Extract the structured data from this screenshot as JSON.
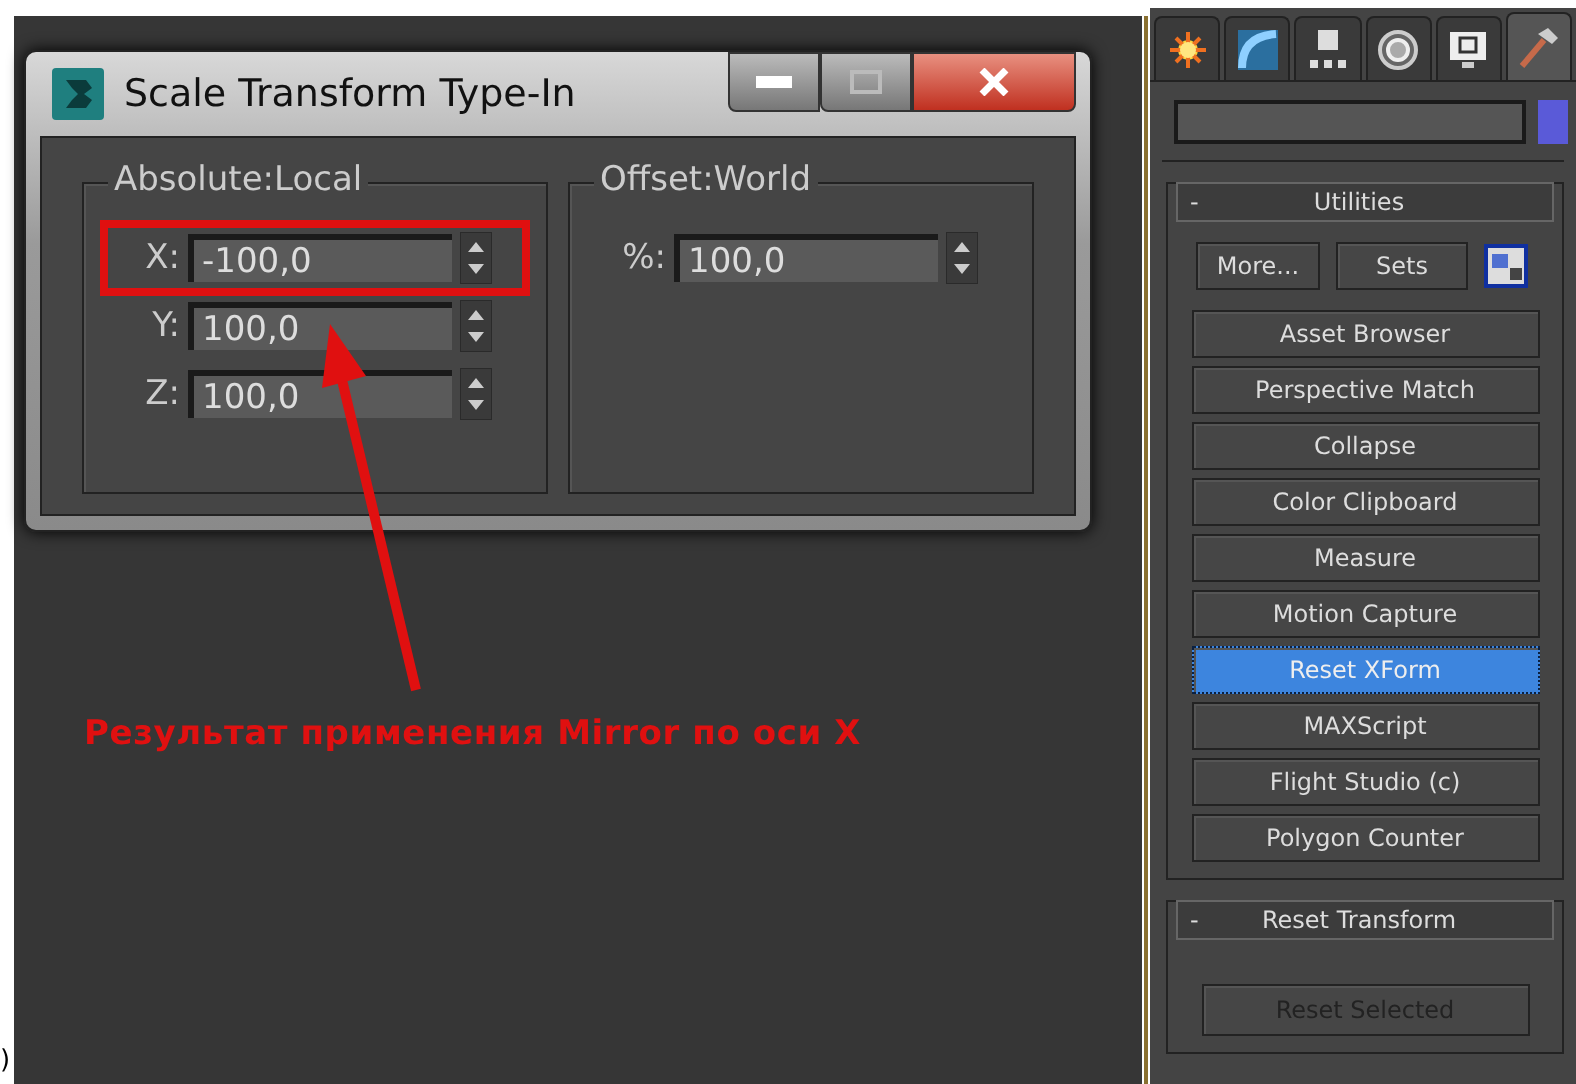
{
  "stray_mark": ")",
  "dialog": {
    "title": "Scale Transform Type-In",
    "groups": [
      {
        "title": "Absolute:Local",
        "fields": [
          {
            "label": "X:",
            "value": "-100,0",
            "highlighted": true
          },
          {
            "label": "Y:",
            "value": "100,0"
          },
          {
            "label": "Z:",
            "value": "100,0"
          }
        ]
      },
      {
        "title": "Offset:World",
        "fields": [
          {
            "label": "%:",
            "value": "100,0"
          }
        ]
      }
    ]
  },
  "annotation": {
    "text": "Результат применения Mirror по оси X"
  },
  "panel": {
    "tabs": [
      {
        "kind": "create",
        "selected": false
      },
      {
        "kind": "modify",
        "selected": false
      },
      {
        "kind": "hierarchy",
        "selected": false
      },
      {
        "kind": "motion",
        "selected": false
      },
      {
        "kind": "display",
        "selected": false
      },
      {
        "kind": "utilities",
        "selected": true
      }
    ],
    "rollouts": [
      {
        "sign": "-",
        "title": "Utilities",
        "top_buttons": [
          "More...",
          "Sets"
        ],
        "buttons": [
          {
            "label": "Asset Browser",
            "selected": false
          },
          {
            "label": "Perspective Match",
            "selected": false
          },
          {
            "label": "Collapse",
            "selected": false
          },
          {
            "label": "Color Clipboard",
            "selected": false
          },
          {
            "label": "Measure",
            "selected": false
          },
          {
            "label": "Motion Capture",
            "selected": false
          },
          {
            "label": "Reset XForm",
            "selected": true
          },
          {
            "label": "MAXScript",
            "selected": false
          },
          {
            "label": "Flight Studio (c)",
            "selected": false
          },
          {
            "label": "Polygon Counter",
            "selected": false
          }
        ]
      },
      {
        "sign": "-",
        "title": "Reset Transform",
        "buttons": [
          {
            "label": "Reset Selected",
            "disabled": true
          }
        ]
      }
    ]
  }
}
